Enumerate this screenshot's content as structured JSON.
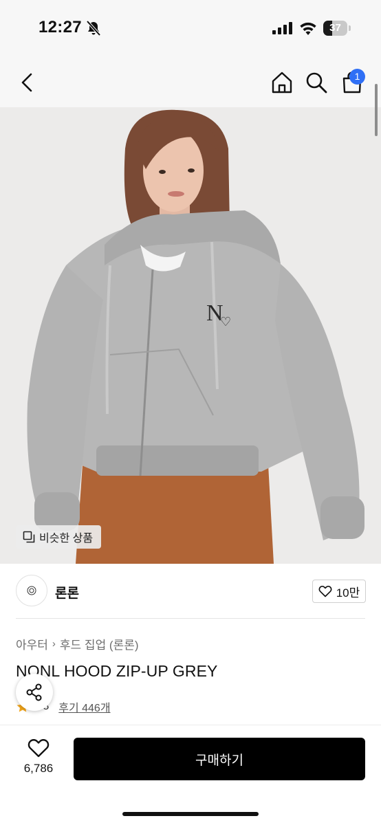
{
  "status_bar": {
    "time": "12:27",
    "battery_level": "37",
    "icons": [
      "bell-slash-icon",
      "cellular-signal-icon",
      "wifi-icon",
      "battery-icon"
    ]
  },
  "nav": {
    "icons": [
      "back-chevron-icon",
      "home-icon",
      "search-icon",
      "cart-icon"
    ],
    "cart_count": "1"
  },
  "product_image": {
    "similar_label": "비슷한 상품"
  },
  "brand": {
    "name": "론론",
    "like_count": "10만"
  },
  "product": {
    "breadcrumb": [
      "아우터",
      "후드 집업 (론론)"
    ],
    "title": "NONL HOOD ZIP-UP GREY",
    "rating": "4.8",
    "reviews_label": "후기 446개"
  },
  "bottom_bar": {
    "wish_count": "6,786",
    "buy_label": "구매하기"
  },
  "colors": {
    "accent_blue": "#2f6ff5",
    "buy_button": "#000000",
    "rating_star": "#f2a51a"
  }
}
